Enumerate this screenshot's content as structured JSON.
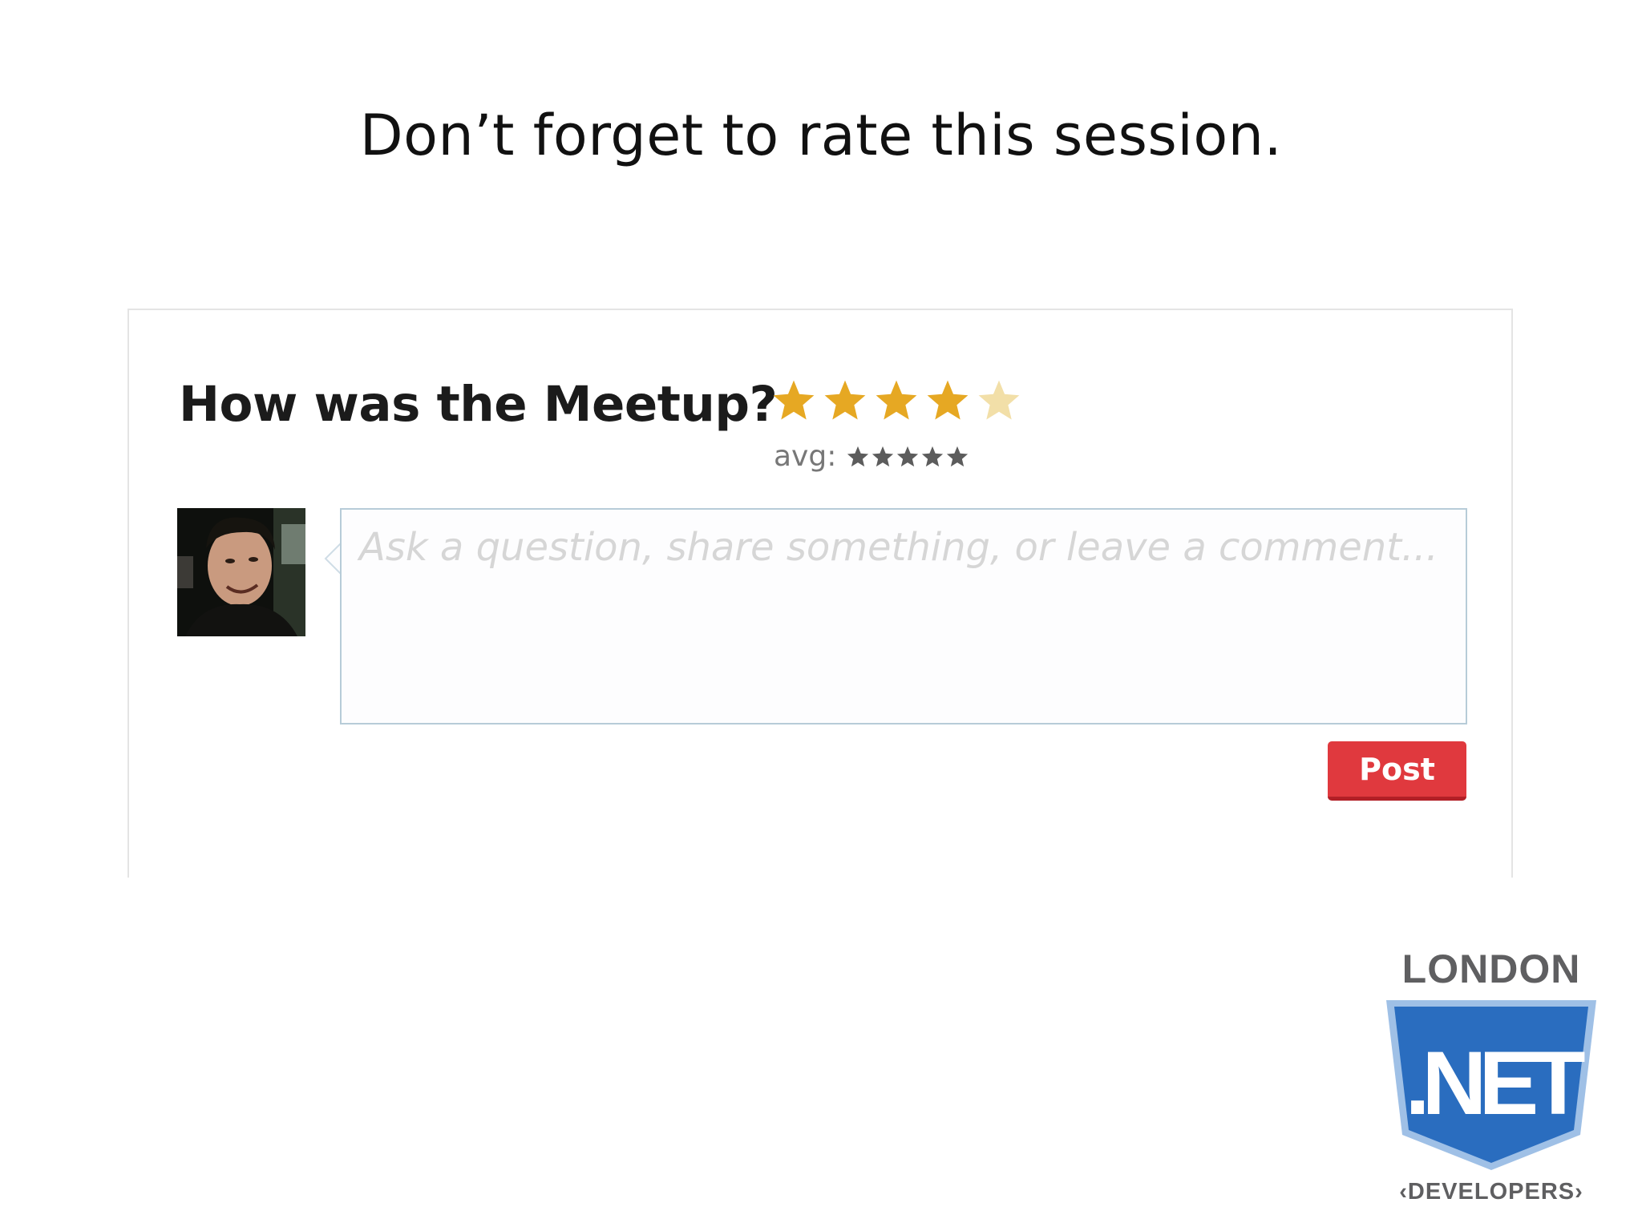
{
  "slide": {
    "title": "Don’t forget to rate this session."
  },
  "rating": {
    "heading": "How was the Meetup?",
    "user_rating": 4,
    "max_rating": 5,
    "star_color": "#e6a823",
    "star_empty_color": "#f2dfa8",
    "avg_label": "avg:",
    "avg_stars": "★★★★★"
  },
  "comment": {
    "value": "",
    "placeholder": "Ask a question, share something, or leave a comment..."
  },
  "post_button": {
    "label": "Post",
    "color": "#e0393e"
  },
  "logo": {
    "top_text": "LONDON",
    "middle_text": ".NET",
    "bottom_text": "‹DEVELOPERS›",
    "shield_color": "#2a6dbf"
  }
}
